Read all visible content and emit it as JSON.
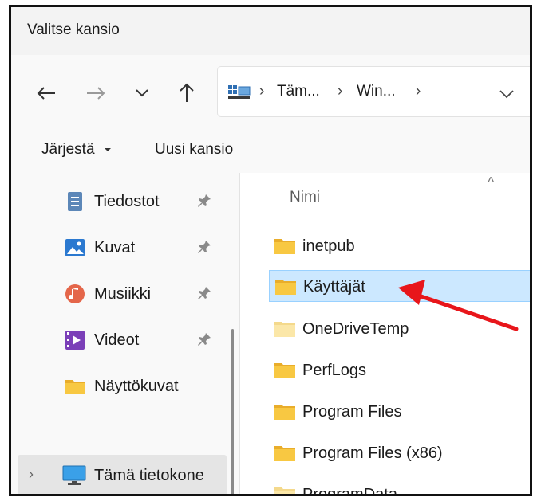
{
  "window": {
    "title": "Valitse kansio"
  },
  "nav": {
    "back_icon": "back-arrow-icon",
    "forward_icon": "forward-arrow-icon",
    "recent_icon": "chevron-down-icon",
    "up_icon": "up-arrow-icon"
  },
  "address": {
    "icon": "this-pc-icon",
    "crumbs": [
      "Täm...",
      "Win..."
    ],
    "separator": "›"
  },
  "commands": {
    "organize": "Järjestä",
    "new_folder": "Uusi kansio"
  },
  "sidebar": {
    "items": [
      {
        "label": "Tiedostot",
        "icon": "documents-icon",
        "pinned": true
      },
      {
        "label": "Kuvat",
        "icon": "pictures-icon",
        "pinned": true
      },
      {
        "label": "Musiikki",
        "icon": "music-icon",
        "pinned": true
      },
      {
        "label": "Videot",
        "icon": "videos-icon",
        "pinned": true
      },
      {
        "label": "Näyttökuvat",
        "icon": "folder-icon",
        "pinned": false
      }
    ],
    "this_pc": {
      "label": "Tämä tietokone",
      "icon": "monitor-icon",
      "expand": "›"
    }
  },
  "main": {
    "column_header": "Nimi",
    "sort_indicator": "^",
    "folders": [
      {
        "name": "inetpub",
        "selected": false
      },
      {
        "name": "Käyttäjät",
        "selected": true
      },
      {
        "name": "OneDriveTemp",
        "selected": false
      },
      {
        "name": "PerfLogs",
        "selected": false
      },
      {
        "name": "Program Files",
        "selected": false
      },
      {
        "name": "Program Files (x86)",
        "selected": false
      },
      {
        "name": "ProgramData",
        "selected": false
      }
    ]
  },
  "colors": {
    "selection_bg": "#cce8ff",
    "selection_border": "#99d1ff",
    "annotation_arrow": "#e8161b",
    "folder_yellow": "#f8c842"
  }
}
